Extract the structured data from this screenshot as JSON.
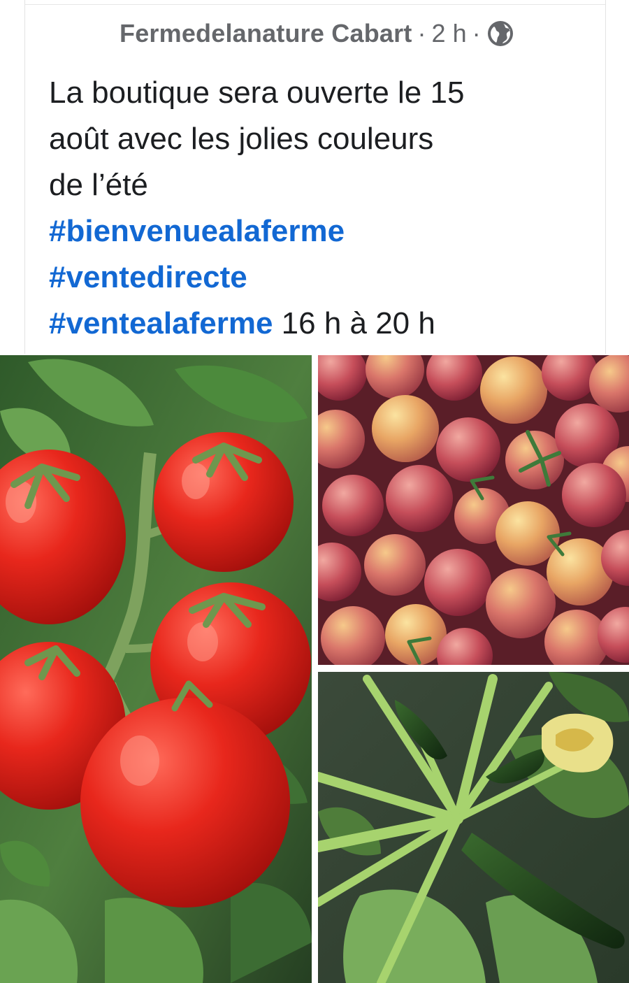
{
  "post": {
    "author": "Fermedelanature Cabart",
    "separator1": "·",
    "time": "2 h",
    "separator2": "·",
    "audience_icon": "globe-icon",
    "text_lines": [
      "La boutique sera ouverte le 15",
      "août avec les jolies couleurs",
      "de l’été"
    ],
    "hashtags": [
      "#bienvenuealaferme",
      "#ventedirecte",
      "#ventealaferme"
    ],
    "trailing_text": "16 h à 20 h"
  },
  "colors": {
    "hashtag": "#1268d3",
    "meta": "#65676b",
    "text": "#1c1e21"
  },
  "photos": [
    {
      "subject": "red-tomatoes-on-vine"
    },
    {
      "subject": "striped-cherry-tomatoes"
    },
    {
      "subject": "zucchini-plant-with-flower"
    }
  ]
}
